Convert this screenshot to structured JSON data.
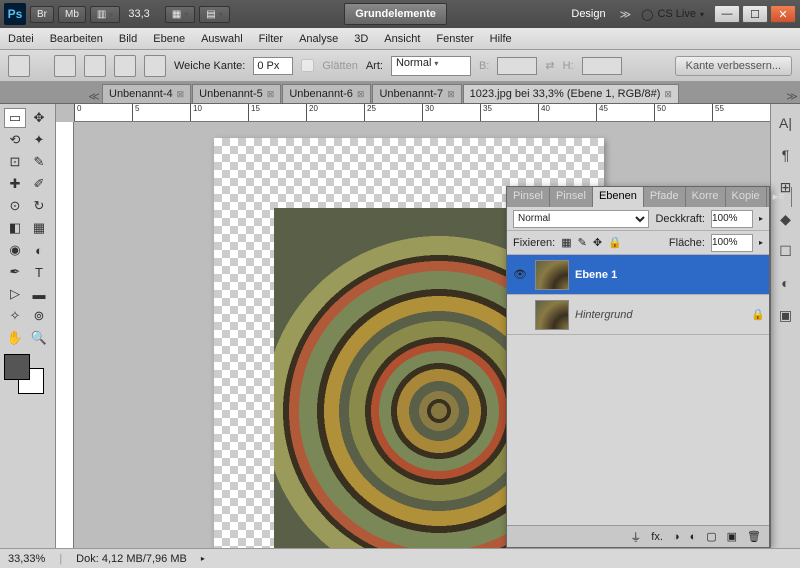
{
  "titlebar": {
    "zoom": "33,3",
    "mode_primary": "Grundelemente",
    "mode_secondary": "Design",
    "cslive": "CS Live"
  },
  "menu": [
    "Datei",
    "Bearbeiten",
    "Bild",
    "Ebene",
    "Auswahl",
    "Filter",
    "Analyse",
    "3D",
    "Ansicht",
    "Fenster",
    "Hilfe"
  ],
  "options": {
    "feather_label": "Weiche Kante:",
    "feather_value": "0 Px",
    "antialias": "Glätten",
    "style_label": "Art:",
    "style_value": "Normal",
    "width_label": "B:",
    "height_label": "H:",
    "refine": "Kante verbessern..."
  },
  "tabs": [
    {
      "label": "Unbenannt-4",
      "active": false
    },
    {
      "label": "Unbenannt-5",
      "active": false
    },
    {
      "label": "Unbenannt-6",
      "active": false
    },
    {
      "label": "Unbenannt-7",
      "active": false
    },
    {
      "label": "1023.jpg bei 33,3% (Ebene 1, RGB/8#)",
      "active": true
    }
  ],
  "ruler_h": [
    "0",
    "5",
    "10",
    "15",
    "20",
    "25",
    "30",
    "35",
    "40",
    "45",
    "50",
    "55"
  ],
  "layers_panel": {
    "tabs": [
      "Pinsel",
      "Pinsel",
      "Ebenen",
      "Pfade",
      "Korre",
      "Kopie"
    ],
    "active_tab": 2,
    "blend": "Normal",
    "opacity_label": "Deckkraft:",
    "opacity": "100%",
    "lock_label": "Fixieren:",
    "fill_label": "Fläche:",
    "fill": "100%",
    "layers": [
      {
        "name": "Ebene 1",
        "visible": true,
        "selected": true,
        "bg": false
      },
      {
        "name": "Hintergrund",
        "visible": false,
        "selected": false,
        "bg": true,
        "locked": true
      }
    ]
  },
  "status": {
    "zoom": "33,33%",
    "doc_label": "Dok:",
    "doc_value": "4,12 MB/7,96 MB"
  }
}
